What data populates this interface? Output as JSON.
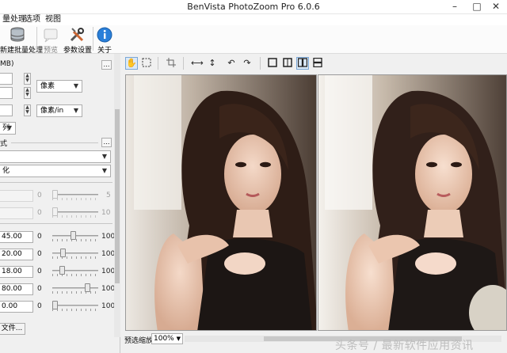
{
  "window": {
    "title": "BenVista PhotoZoom Pro 6.0.6"
  },
  "menu": {
    "items": [
      "量处理",
      "选项",
      "视图"
    ]
  },
  "toolbar": {
    "buttons": [
      {
        "label": "新建批量处理",
        "icon": "database-icon"
      },
      {
        "label": "预览",
        "icon": "preview-icon"
      },
      {
        "label": "参数设置",
        "icon": "settings-tools-icon"
      },
      {
        "label": "关于",
        "icon": "info-icon"
      }
    ]
  },
  "left_panel": {
    "header_fragment": "MB)",
    "unit_pixels": "像素",
    "unit_resolution": "像素/in",
    "ratio_label": "列",
    "method_label": "式",
    "preset_label": "化",
    "disabled_rows": [
      {
        "min": "0",
        "max": "5"
      },
      {
        "min": "0",
        "max": "10"
      }
    ],
    "params": [
      {
        "value": "45.00",
        "min": "0",
        "max": "100",
        "level": 0.45
      },
      {
        "value": "20.00",
        "min": "0",
        "max": "100",
        "level": 0.2
      },
      {
        "value": "18.00",
        "min": "0",
        "max": "100",
        "level": 0.18
      },
      {
        "value": "80.00",
        "min": "0",
        "max": "100",
        "level": 0.8
      },
      {
        "value": "0.00",
        "min": "0",
        "max": "100",
        "level": 0.0
      }
    ],
    "file_button": "文件..."
  },
  "view_tools": [
    "hand-icon",
    "marquee-icon",
    "crop-icon",
    "fit-width-icon",
    "fit-height-icon",
    "rotate-left-icon",
    "rotate-right-icon",
    "single-view-icon",
    "split-view-icon",
    "side-by-side-icon",
    "stacked-view-icon"
  ],
  "status": {
    "zoom_label": "预选缩放:",
    "zoom_value": "100%"
  },
  "watermark": "头条号 / 最新软件应用资讯"
}
